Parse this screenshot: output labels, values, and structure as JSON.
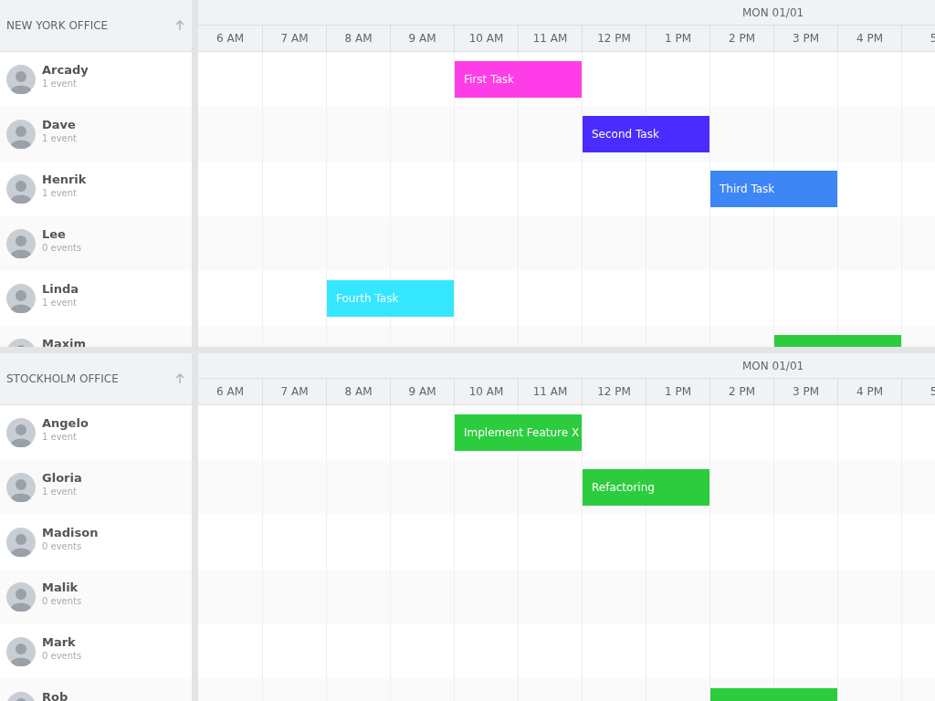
{
  "offices": [
    {
      "name": "NEW YORK OFFICE",
      "day": "MON 01/01",
      "hours": [
        "6 AM",
        "7 AM",
        "8 AM",
        "9 AM",
        "10 AM",
        "11 AM",
        "12 PM",
        "1 PM",
        "2 PM",
        "3 PM",
        "4 PM",
        "5"
      ],
      "people": [
        {
          "name": "Arcady",
          "count": "1 event",
          "slots": [
            {
              "kind": "free"
            },
            {
              "kind": "free"
            },
            {
              "kind": "free"
            },
            {
              "kind": "free"
            },
            {
              "kind": "start",
              "title": "First Task",
              "color": "#ff3de8"
            },
            {
              "kind": "busy"
            }
          ]
        },
        {
          "name": "Dave",
          "count": "1 event",
          "slots": [
            {
              "kind": "free"
            },
            {
              "kind": "free"
            },
            {
              "kind": "free"
            },
            {
              "kind": "free"
            },
            {
              "kind": "free"
            },
            {
              "kind": "free"
            },
            {
              "kind": "start",
              "title": "Second Task",
              "color": "#4a2cff"
            },
            {
              "kind": "busy"
            }
          ]
        },
        {
          "name": "Henrik",
          "count": "1 event",
          "slots": [
            {
              "kind": "free"
            },
            {
              "kind": "free"
            },
            {
              "kind": "free"
            },
            {
              "kind": "free"
            },
            {
              "kind": "free"
            },
            {
              "kind": "free"
            },
            {
              "kind": "free"
            },
            {
              "kind": "free"
            },
            {
              "kind": "start",
              "title": "Third Task",
              "color": "#3d86f6"
            },
            {
              "kind": "busy"
            }
          ]
        },
        {
          "name": "Lee",
          "count": "0 events"
        },
        {
          "name": "Linda",
          "count": "1 event",
          "slots": [
            {
              "kind": "free"
            },
            {
              "kind": "free"
            },
            {
              "kind": "start",
              "title": "Fourth Task",
              "color": "#34e6ff"
            },
            {
              "kind": "busy"
            }
          ]
        },
        {
          "name": "Maxim",
          "slots": [
            {
              "kind": "free"
            },
            {
              "kind": "free"
            },
            {
              "kind": "free"
            },
            {
              "kind": "free"
            },
            {
              "kind": "free"
            },
            {
              "kind": "free"
            },
            {
              "kind": "free"
            },
            {
              "kind": "free"
            },
            {
              "kind": "free"
            },
            {
              "kind": "start",
              "color": "#2ccc3e"
            },
            {
              "kind": "busy"
            }
          ]
        }
      ]
    },
    {
      "name": "STOCKHOLM OFFICE",
      "day": "MON 01/01",
      "hours": [
        "6 AM",
        "7 AM",
        "8 AM",
        "9 AM",
        "10 AM",
        "11 AM",
        "12 PM",
        "1 PM",
        "2 PM",
        "3 PM",
        "4 PM",
        "5"
      ],
      "people": [
        {
          "name": "Angelo",
          "count": "1 event",
          "slots": [
            {
              "kind": "free"
            },
            {
              "kind": "free"
            },
            {
              "kind": "free"
            },
            {
              "kind": "free"
            },
            {
              "kind": "start",
              "title": "Implement Feature X",
              "color": "#2ccc3e"
            },
            {
              "kind": "busy"
            }
          ]
        },
        {
          "name": "Gloria",
          "count": "1 event",
          "slots": [
            {
              "kind": "free"
            },
            {
              "kind": "free"
            },
            {
              "kind": "free"
            },
            {
              "kind": "free"
            },
            {
              "kind": "free"
            },
            {
              "kind": "free"
            },
            {
              "kind": "start",
              "title": "Refactoring",
              "color": "#2ccc3e"
            },
            {
              "kind": "busy"
            }
          ]
        },
        {
          "name": "Madison",
          "count": "0 events"
        },
        {
          "name": "Malik",
          "count": "0 events"
        },
        {
          "name": "Mark",
          "count": "0 events"
        },
        {
          "name": "Rob",
          "slots": [
            {
              "kind": "free"
            },
            {
              "kind": "free"
            },
            {
              "kind": "free"
            },
            {
              "kind": "free"
            },
            {
              "kind": "free"
            },
            {
              "kind": "free"
            },
            {
              "kind": "free"
            },
            {
              "kind": "free"
            },
            {
              "kind": "start",
              "color": "#2ccc3e"
            },
            {
              "kind": "busy"
            }
          ]
        }
      ]
    }
  ]
}
